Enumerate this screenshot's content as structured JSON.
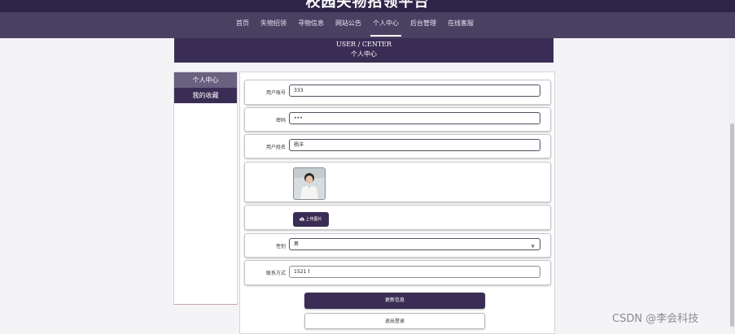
{
  "header": {
    "site_title": "校园失物招领平台",
    "nav": [
      "首页",
      "失物招领",
      "寻物信息",
      "网站公告",
      "个人中心",
      "后台管理",
      "在线客服"
    ],
    "active_nav": "个人中心"
  },
  "banner": {
    "en": "USER / CENTER",
    "cn": "个人中心"
  },
  "sidebar": {
    "items": [
      "个人中心",
      "我的收藏"
    ]
  },
  "form": {
    "account_label": "用户账号",
    "account_value": "333",
    "password_label": "密码",
    "password_value": "•••",
    "name_label": "用户姓名",
    "name_value": "杨洋",
    "upload_label": "上传图片",
    "gender_label": "性别",
    "gender_value": "男",
    "contact_label": "联系方式",
    "contact_value": "1521"
  },
  "buttons": {
    "update": "更新信息",
    "logout": "退出登录"
  },
  "watermark": "CSDN @李会科技",
  "colors": {
    "primary": "#3a2d55",
    "nav_bg": "#4a4062"
  },
  "icons": {
    "upload": "cloud-upload-icon",
    "select": "chevron-down-icon"
  }
}
